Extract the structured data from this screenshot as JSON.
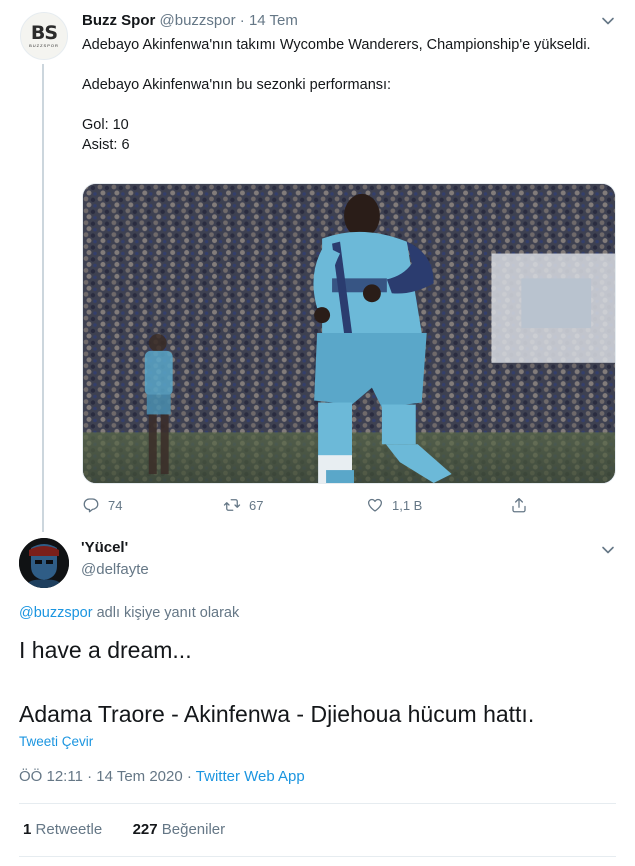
{
  "tweet": {
    "avatar": {
      "monogram": "BS",
      "subtext": "BUZZSPOR"
    },
    "author_name": "Buzz Spor",
    "handle": "@buzzspor",
    "separator": "·",
    "date": "14 Tem",
    "lines": [
      "Adebayo Akinfenwa'nın takımı Wycombe Wanderers, Championship'e yükseldi.",
      "Adebayo Akinfenwa'nın bu sezonki performansı:",
      "Gol: 10",
      "Asist: 6"
    ],
    "actions": {
      "reply_count": "74",
      "retweet_count": "67",
      "like_count": "1,1 B"
    },
    "icons": [
      "reply-icon",
      "retweet-icon",
      "like-icon",
      "share-icon",
      "chevron-down-icon"
    ]
  },
  "reply": {
    "author_name": "'Yücel'",
    "handle": "@delfayte",
    "replying_link": "@buzzspor",
    "replying_suffix": "adlı kişiye yanıt olarak",
    "line1": "I have a dream...",
    "line2": "Adama Traore - Akinfenwa - Djiehoua hücum hattı.",
    "translate_label": "Tweeti Çevir",
    "time": "ÖÖ 12:11 · 14 Tem 2020 ·",
    "source": "Twitter Web App",
    "retweets_count": "1",
    "retweets_label": "Retweetle",
    "likes_count": "227",
    "likes_label": "Beğeniler"
  },
  "colors": {
    "link": "#1b95e0",
    "muted": "#657786",
    "text": "#14171a",
    "border": "#e6ecf0"
  }
}
